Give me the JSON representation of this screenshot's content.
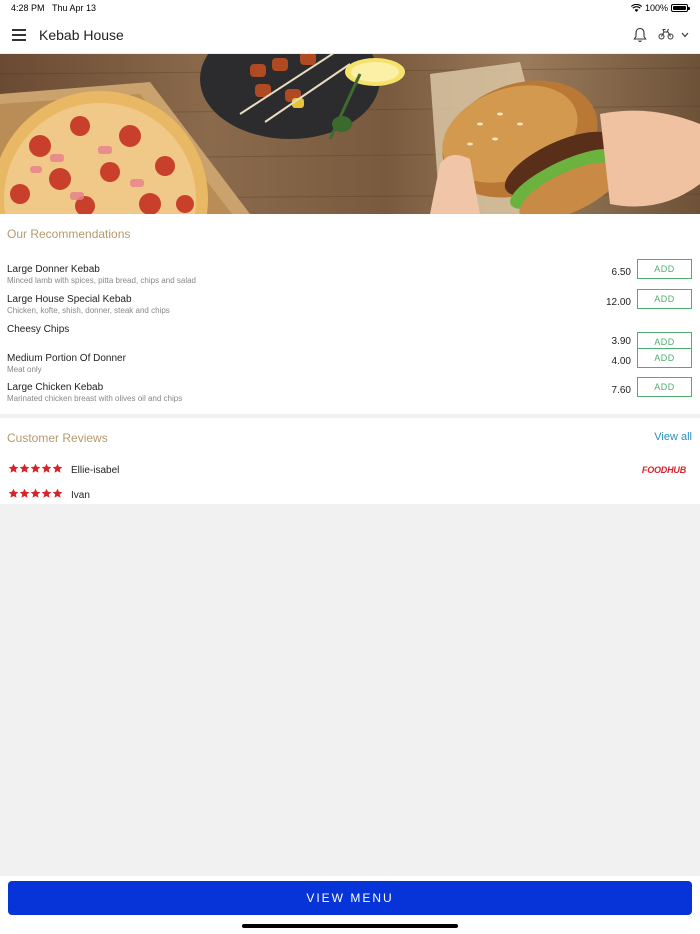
{
  "status_bar": {
    "time": "4:28 PM",
    "date": "Thu Apr 13",
    "battery": "100%",
    "battery_level": 1.0
  },
  "header": {
    "title": "Kebab House",
    "icons": [
      "menu-icon",
      "bell-icon",
      "delivery-rider-icon",
      "chevron-down-icon"
    ]
  },
  "recommendations": {
    "title": "Our Recommendations",
    "items": [
      {
        "name": "Large Donner Kebab",
        "desc": "Minced lamb with spices, pitta bread, chips and salad",
        "price": "6.50",
        "add": "ADD"
      },
      {
        "name": "Large House Special Kebab",
        "desc": "Chicken, kofte, shish, donner, steak and chips",
        "price": "12.00",
        "add": "ADD"
      },
      {
        "name": "Cheesy Chips",
        "desc": "",
        "price": "3.90",
        "add": "ADD"
      },
      {
        "name": "Medium Portion Of Donner",
        "desc": "Meat only",
        "price": "4.00",
        "add": "ADD"
      },
      {
        "name": "Large Chicken Kebab",
        "desc": "Marinated chicken breast with olives oil and chips",
        "price": "7.60",
        "add": "ADD"
      }
    ]
  },
  "reviews": {
    "title": "Customer Reviews",
    "view_all": "View all",
    "items": [
      {
        "name": "Ellie-isabel",
        "rating": 5,
        "source": "FOODHUB"
      },
      {
        "name": "Ivan",
        "rating": 5,
        "source": ""
      }
    ]
  },
  "footer": {
    "view_menu": "VIEW MENU"
  },
  "colors": {
    "accent_gold": "#b69a6d",
    "add_green": "#4caf6d",
    "primary_blue": "#0634d8",
    "star_red": "#d8232a",
    "link_blue": "#2a8fbf"
  }
}
